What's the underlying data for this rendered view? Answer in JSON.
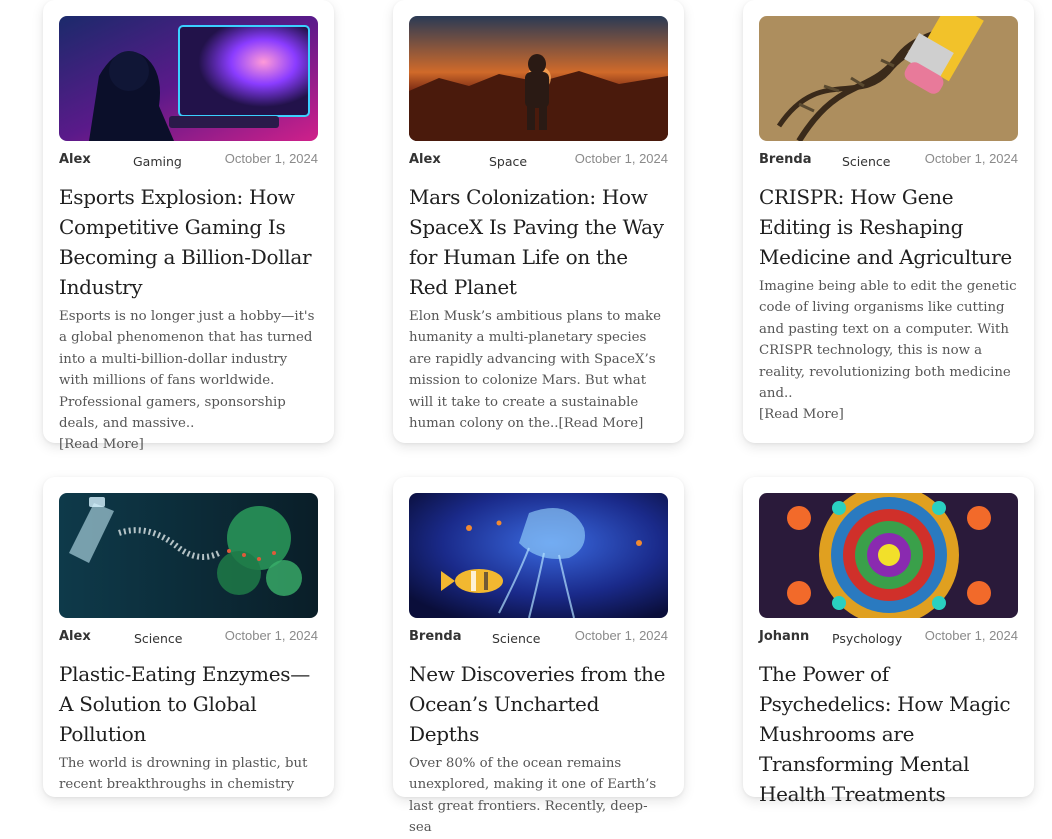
{
  "posts": [
    {
      "author": "Alex",
      "category": "Gaming",
      "date": "October 1, 2024",
      "title": "Esports Explosion: How Competitive Gaming Is Becoming a Billion-Dollar Industry",
      "excerpt": "Esports is no longer just a hobby—it's a global phenomenon that has turned into a multi-billion-dollar industry with millions of fans worldwide. Professional gamers, sponsorship deals, and massive..",
      "read_more": "[Read More]",
      "image": "gamer-neon-monitor"
    },
    {
      "author": "Alex",
      "category": "Space",
      "date": "October 1, 2024",
      "title": "Mars Colonization: How SpaceX Is Paving the Way for Human Life on the Red Planet",
      "excerpt": "Elon Musk’s ambitious plans to make humanity a multi-planetary species are rapidly advancing with SpaceX’s mission to colonize Mars. But what will it take to create a sustainable human colony on the..",
      "read_more": "[Read More]",
      "image": "astronaut-mars-sunset"
    },
    {
      "author": "Brenda",
      "category": "Science",
      "date": "October 1, 2024",
      "title": "CRISPR: How Gene Editing is Reshaping Medicine and Agriculture",
      "excerpt": "Imagine being able to edit the genetic code of living organisms like cutting and pasting text on a computer. With CRISPR technology, this is now a reality, revolutionizing both medicine and..",
      "read_more": "[Read More]",
      "image": "pencil-dna-helix"
    },
    {
      "author": "Alex",
      "category": "Science",
      "date": "October 1, 2024",
      "title": "Plastic-Eating Enzymes—A Solution to Global Pollution",
      "excerpt": "The world is drowning in plastic, but recent breakthroughs in chemistry",
      "read_more": "",
      "image": "enzyme-plastic-bottle"
    },
    {
      "author": "Brenda",
      "category": "Science",
      "date": "October 1, 2024",
      "title": "New Discoveries from the Ocean’s Uncharted Depths",
      "excerpt": "Over 80% of the ocean remains unexplored, making it one of Earth’s last great frontiers. Recently, deep-sea",
      "read_more": "",
      "image": "deep-sea-jellyfish"
    },
    {
      "author": "Johann",
      "category": "Psychology",
      "date": "October 1, 2024",
      "title": "The Power of Psychedelics: How Magic Mushrooms are Transforming Mental Health Treatments",
      "excerpt": "",
      "read_more": "",
      "image": "psychedelic-mandala"
    }
  ]
}
